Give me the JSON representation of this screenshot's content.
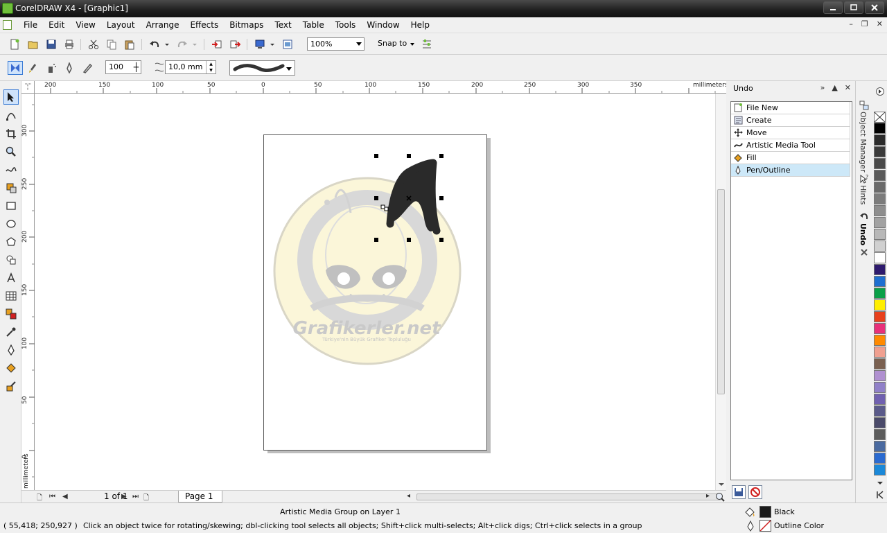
{
  "window": {
    "title": "CorelDRAW X4 - [Graphic1]",
    "controls": [
      "minimize",
      "maximize",
      "close"
    ]
  },
  "menu": {
    "items": [
      "File",
      "Edit",
      "View",
      "Layout",
      "Arrange",
      "Effects",
      "Bitmaps",
      "Text",
      "Table",
      "Tools",
      "Window",
      "Help"
    ]
  },
  "standard_toolbar": {
    "zoom_level": "100%",
    "snap_to": "Snap to",
    "icons": [
      "new-document-icon",
      "open-icon",
      "save-icon",
      "print-icon",
      "cut-icon",
      "copy-icon",
      "paste-icon",
      "undo-icon",
      "redo-icon",
      "import-icon",
      "export-icon",
      "application-launcher-icon",
      "welcome-screen-icon",
      "options-icon"
    ]
  },
  "property_bar": {
    "smoothing_value": "100",
    "stroke_width": "10,0 mm",
    "modes": [
      "preset-icon",
      "brush-icon",
      "sprayer-icon",
      "calligraphic-icon",
      "pressure-icon"
    ]
  },
  "toolbox": {
    "tools": [
      "pick-tool-icon",
      "shape-tool-icon",
      "crop-tool-icon",
      "zoom-tool-icon",
      "freehand-tool-icon",
      "smart-fill-tool-icon",
      "rectangle-tool-icon",
      "ellipse-tool-icon",
      "polygon-tool-icon",
      "basic-shapes-tool-icon",
      "text-tool-icon",
      "table-tool-icon",
      "blend-tool-icon",
      "eyedropper-tool-icon",
      "outline-tool-icon",
      "fill-tool-icon",
      "interactive-fill-tool-icon"
    ]
  },
  "rulers": {
    "unit": "millimeters",
    "top_ticks": [
      "200",
      "150",
      "100",
      "50",
      "0",
      "50",
      "100",
      "150",
      "200",
      "250",
      "300",
      "350"
    ],
    "left_ticks": [
      "300",
      "250",
      "200",
      "150",
      "100",
      "50",
      "0"
    ],
    "left_unit": "millimeters"
  },
  "canvas": {
    "watermark_text": "Grafikerler.net",
    "watermark_subtext": "Türkiye'nin Büyük Grafiker Topluluğu"
  },
  "page_nav": {
    "page_count": "1 of 1",
    "page_tab": "Page 1"
  },
  "undo_docker": {
    "title": "Undo",
    "items": [
      {
        "label": "File New",
        "icon": "file-new-icon",
        "selected": false
      },
      {
        "label": "Create",
        "icon": "create-icon",
        "selected": false
      },
      {
        "label": "Move",
        "icon": "move-icon",
        "selected": false
      },
      {
        "label": "Artistic Media Tool",
        "icon": "artistic-media-icon",
        "selected": false
      },
      {
        "label": "Fill",
        "icon": "fill-icon",
        "selected": false
      },
      {
        "label": "Pen/Outline",
        "icon": "pen-outline-icon",
        "selected": true
      }
    ],
    "footer_buttons": [
      "save-undo-list-icon",
      "clear-undo-list-icon"
    ]
  },
  "docker_tabs": [
    "Object Manager",
    "Hints",
    "Undo"
  ],
  "palette": {
    "colors": [
      "#2b2b2b",
      "#3a3a3a",
      "#4a4a4a",
      "#5a5a5a",
      "#6a6a6a",
      "#7c7c7c",
      "#8e8e8e",
      "#a2a2a2",
      "#b8b8b8",
      "#d0d0d0",
      "#ffffff",
      "#2e1a6e",
      "#1e6fd0",
      "#0aa048",
      "#ffef00",
      "#e8401c",
      "#e8307a",
      "#ff8a00",
      "#f0a090",
      "#7a6050",
      "#b090d0",
      "#9080c8",
      "#7060b0",
      "#5a5a8a",
      "#4a4a6a",
      "#5c5c5c",
      "#4a6aa0",
      "#2a6ad0",
      "#1a88d8"
    ]
  },
  "status": {
    "object_info": "Artistic Media Group on Layer 1",
    "coords": "( 55,418; 250,927 )",
    "hint": "Click an object twice for rotating/skewing; dbl-clicking tool selects all objects; Shift+click multi-selects; Alt+click digs; Ctrl+click selects in a group",
    "fill_label": "Black",
    "outline_label": "Outline Color",
    "fill_color": "#1a1a1a"
  }
}
